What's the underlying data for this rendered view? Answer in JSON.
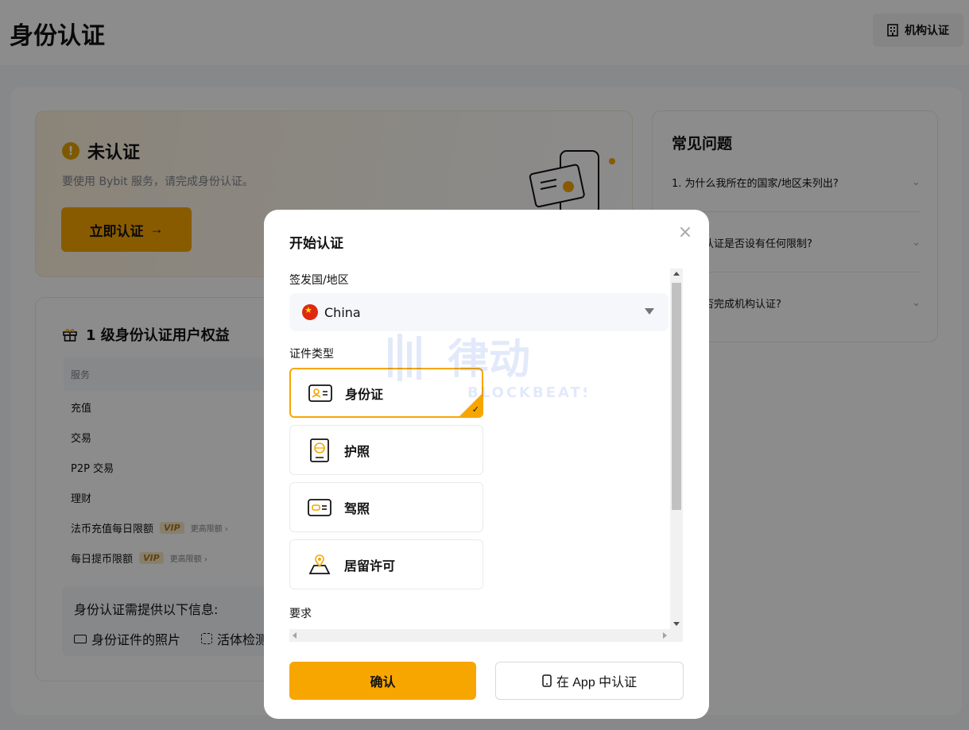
{
  "page": {
    "title": "身份认证",
    "org_button": "机构认证"
  },
  "status": {
    "title": "未认证",
    "warn_symbol": "!",
    "description": "要使用 Bybit 服务，请完成身份认证。",
    "verify_button": "立即认证"
  },
  "benefits": {
    "title": "1 级身份认证用户权益",
    "table_header": "服务",
    "rows": [
      {
        "label": "充值"
      },
      {
        "label": "交易"
      },
      {
        "label": "P2P 交易"
      },
      {
        "label": "理财"
      },
      {
        "label": "法币充值每日限额",
        "vip": "VIP",
        "more": "更高限额"
      },
      {
        "label": "每日提币限额",
        "vip": "VIP",
        "more": "更高限额"
      }
    ],
    "info_title": "身份认证需提供以下信息:",
    "info_items": [
      "身份证件的照片",
      "活体检测"
    ]
  },
  "faq": {
    "title": "常见问题",
    "items": [
      "1. 为什么我所在的国家/地区未列出?",
      "认证是否设有任何限制?",
      "否完成机构认证?"
    ]
  },
  "modal": {
    "title": "开始认证",
    "close_symbol": "×",
    "country_label": "签发国/地区",
    "country_value": "China",
    "doc_type_label": "证件类型",
    "doc_types": [
      "身份证",
      "护照",
      "驾照",
      "居留许可"
    ],
    "requirements_label": "要求",
    "confirm_button": "确认",
    "app_button": "在 App 中认证"
  },
  "watermark": {
    "cn": "律动",
    "en": "BLOCKBEATS"
  },
  "colors": {
    "accent": "#f7a600",
    "overlay": "rgba(0,0,0,0.45)"
  }
}
